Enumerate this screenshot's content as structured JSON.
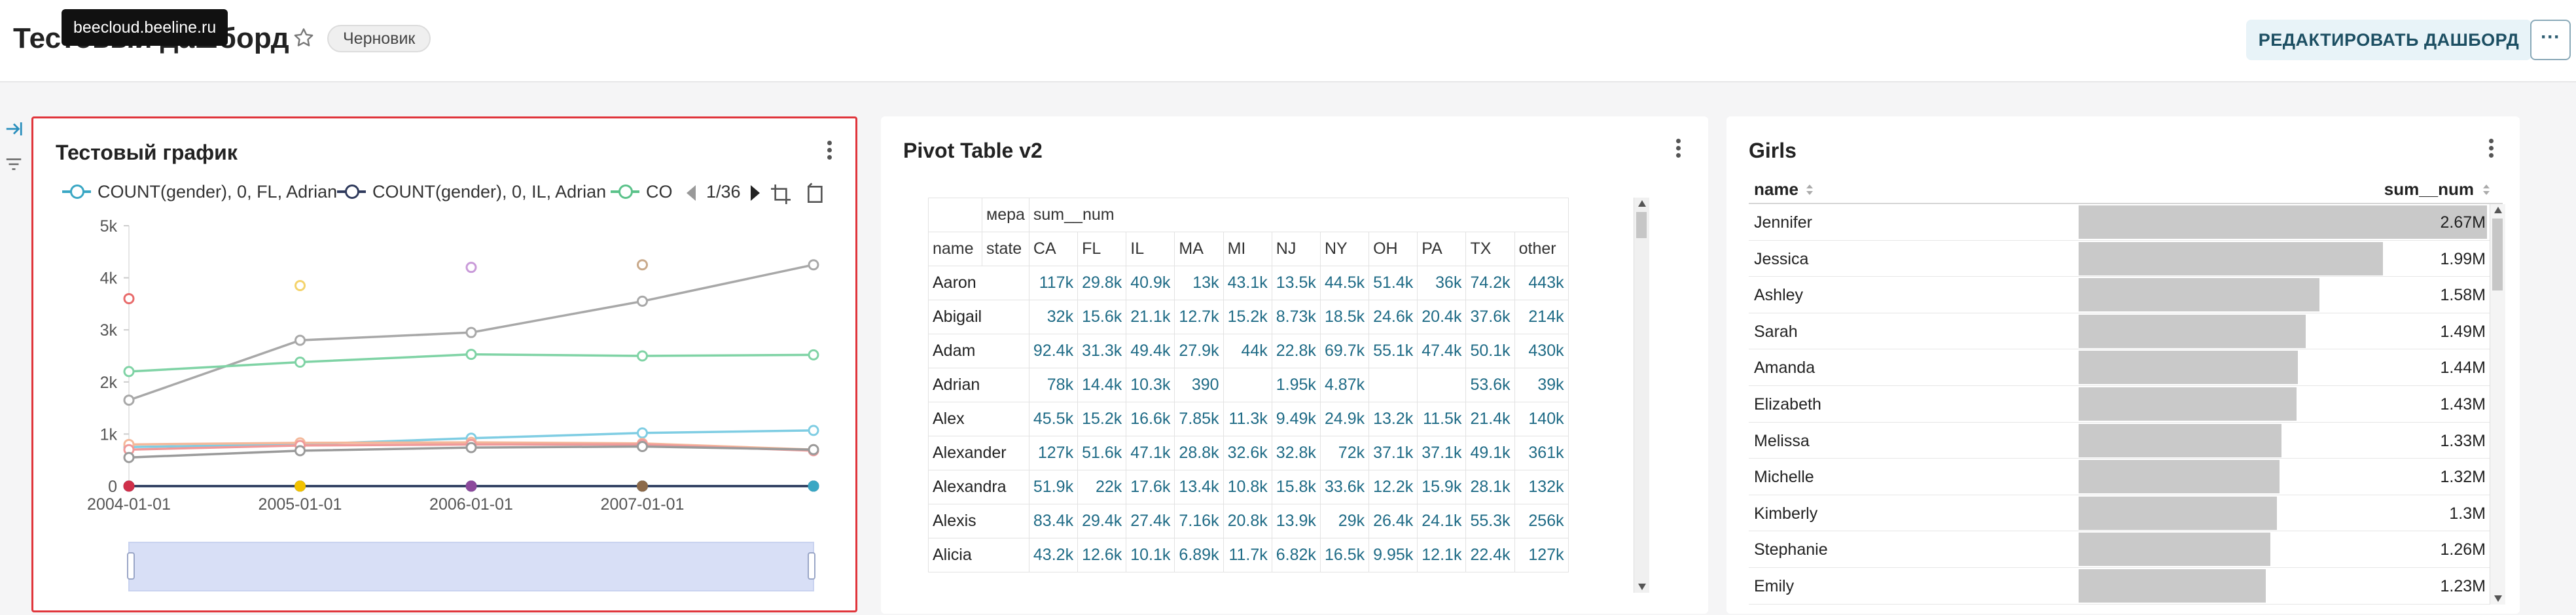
{
  "header": {
    "title": "Тестовый дашборд",
    "draft_badge": "Черновик",
    "tooltip": "beecloud.beeline.ru",
    "edit_button": "РЕДАКТИРОВАТЬ ДАШБОРД",
    "more_button": "···"
  },
  "chart_panel": {
    "title": "Тестовый график",
    "legend": [
      {
        "label": "COUNT(gender), 0, FL, Adrian",
        "color": "#3aa7c4"
      },
      {
        "label": "COUNT(gender), 0, IL, Adrian",
        "color": "#2f3a5c"
      },
      {
        "label": "CO",
        "color": "#5bc28a"
      }
    ],
    "pager": "1/36"
  },
  "chart_data": {
    "type": "line",
    "x": [
      "2004-01-01",
      "2005-01-01",
      "2006-01-01",
      "2007-01-01",
      "2008-01-01"
    ],
    "x_tick_labels": [
      "2004-01-01",
      "2005-01-01",
      "2006-01-01",
      "2007-01-01"
    ],
    "y_tick_labels": [
      "0",
      "1k",
      "2k",
      "3k",
      "4k",
      "5k"
    ],
    "ylim": [
      0,
      5000
    ],
    "legend_position": "top",
    "series": [
      {
        "color": "#a8a8a8",
        "values": [
          1650,
          2800,
          2950,
          3550,
          4250
        ]
      },
      {
        "color": "#7fd3a5",
        "values": [
          2200,
          2380,
          2530,
          2500,
          2520
        ]
      },
      {
        "color": "#7fcde3",
        "values": [
          750,
          800,
          920,
          1020,
          1070
        ]
      },
      {
        "color": "#f4b89a",
        "values": [
          800,
          830,
          840,
          820,
          700
        ]
      },
      {
        "color": "#f09a9a",
        "values": [
          700,
          780,
          800,
          800,
          680
        ]
      },
      {
        "color": "#9a9a9a",
        "values": [
          550,
          680,
          740,
          760,
          700
        ]
      },
      {
        "color": "#3aa7c4",
        "values": [
          0,
          0,
          0,
          0,
          0
        ]
      },
      {
        "color": "#2f3a5c",
        "values": [
          0,
          0,
          0,
          0,
          0
        ]
      }
    ],
    "scatter_points": [
      {
        "x": "2004-01-01",
        "y": 3600,
        "color": "#e86b6b"
      },
      {
        "x": "2005-01-01",
        "y": 3850,
        "color": "#f4d36b"
      },
      {
        "x": "2006-01-01",
        "y": 4200,
        "color": "#c99ad9"
      },
      {
        "x": "2007-01-01",
        "y": 4250,
        "color": "#c9a98a"
      },
      {
        "x": "2004-01-01",
        "y": 0,
        "color": "#d0304a"
      },
      {
        "x": "2005-01-01",
        "y": 0,
        "color": "#f2c200"
      },
      {
        "x": "2006-01-01",
        "y": 0,
        "color": "#8c4a9c"
      },
      {
        "x": "2007-01-01",
        "y": 0,
        "color": "#8c6a4a"
      },
      {
        "x": "2008-01-01",
        "y": 0,
        "color": "#3aa7c4"
      }
    ]
  },
  "pivot_panel": {
    "title": "Pivot Table v2",
    "measure_label": "мера",
    "measure_value": "sum__num",
    "state_label": "state",
    "name_label": "name",
    "columns": [
      "CA",
      "FL",
      "IL",
      "MA",
      "MI",
      "NJ",
      "NY",
      "OH",
      "PA",
      "TX",
      "other"
    ],
    "rows": [
      {
        "name": "Aaron",
        "values": [
          "117k",
          "29.8k",
          "40.9k",
          "13k",
          "43.1k",
          "13.5k",
          "44.5k",
          "51.4k",
          "36k",
          "74.2k",
          "443k"
        ]
      },
      {
        "name": "Abigail",
        "values": [
          "32k",
          "15.6k",
          "21.1k",
          "12.7k",
          "15.2k",
          "8.73k",
          "18.5k",
          "24.6k",
          "20.4k",
          "37.6k",
          "214k"
        ]
      },
      {
        "name": "Adam",
        "values": [
          "92.4k",
          "31.3k",
          "49.4k",
          "27.9k",
          "44k",
          "22.8k",
          "69.7k",
          "55.1k",
          "47.4k",
          "50.1k",
          "430k"
        ]
      },
      {
        "name": "Adrian",
        "values": [
          "78k",
          "14.4k",
          "10.3k",
          "390",
          "",
          "1.95k",
          "4.87k",
          "",
          "",
          "53.6k",
          "39k"
        ]
      },
      {
        "name": "Alex",
        "values": [
          "45.5k",
          "15.2k",
          "16.6k",
          "7.85k",
          "11.3k",
          "9.49k",
          "24.9k",
          "13.2k",
          "11.5k",
          "21.4k",
          "140k"
        ]
      },
      {
        "name": "Alexander",
        "values": [
          "127k",
          "51.6k",
          "47.1k",
          "28.8k",
          "32.6k",
          "32.8k",
          "72k",
          "37.1k",
          "37.1k",
          "49.1k",
          "361k"
        ]
      },
      {
        "name": "Alexandra",
        "values": [
          "51.9k",
          "22k",
          "17.6k",
          "13.4k",
          "10.8k",
          "15.8k",
          "33.6k",
          "12.2k",
          "15.9k",
          "28.1k",
          "132k"
        ]
      },
      {
        "name": "Alexis",
        "values": [
          "83.4k",
          "29.4k",
          "27.4k",
          "7.16k",
          "20.8k",
          "13.9k",
          "29k",
          "26.4k",
          "24.1k",
          "55.3k",
          "256k"
        ]
      },
      {
        "name": "Alicia",
        "values": [
          "43.2k",
          "12.6k",
          "10.1k",
          "6.89k",
          "11.7k",
          "6.82k",
          "16.5k",
          "9.95k",
          "12.1k",
          "22.4k",
          "127k"
        ]
      }
    ]
  },
  "girls_panel": {
    "title": "Girls",
    "col_name": "name",
    "col_value": "sum__num",
    "rows": [
      {
        "name": "Jennifer",
        "value": "2.67M",
        "fraction": 1.0
      },
      {
        "name": "Jessica",
        "value": "1.99M",
        "fraction": 0.745
      },
      {
        "name": "Ashley",
        "value": "1.58M",
        "fraction": 0.59
      },
      {
        "name": "Sarah",
        "value": "1.49M",
        "fraction": 0.556
      },
      {
        "name": "Amanda",
        "value": "1.44M",
        "fraction": 0.537
      },
      {
        "name": "Elizabeth",
        "value": "1.43M",
        "fraction": 0.533
      },
      {
        "name": "Melissa",
        "value": "1.33M",
        "fraction": 0.496
      },
      {
        "name": "Michelle",
        "value": "1.32M",
        "fraction": 0.492
      },
      {
        "name": "Kimberly",
        "value": "1.3M",
        "fraction": 0.485
      },
      {
        "name": "Stephanie",
        "value": "1.26M",
        "fraction": 0.47
      },
      {
        "name": "Emily",
        "value": "1.23M",
        "fraction": 0.459
      }
    ]
  }
}
